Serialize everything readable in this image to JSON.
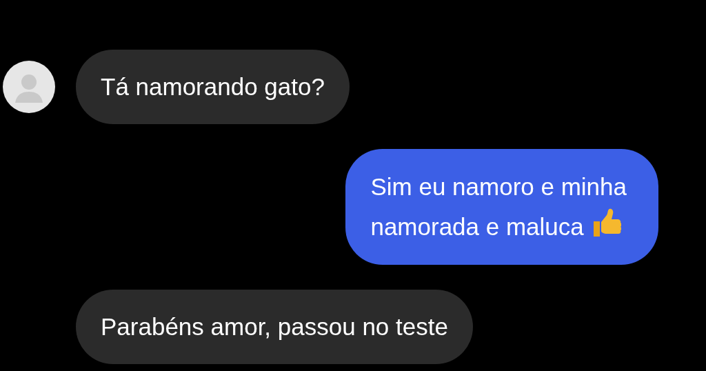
{
  "messages": [
    {
      "kind": "received",
      "show_avatar": true,
      "lines": [
        "Tá namorando gato?"
      ]
    },
    {
      "kind": "sent",
      "show_avatar": false,
      "lines": [
        "Sim eu namoro e minha",
        "namorada e maluca"
      ],
      "thumbs_up": true
    },
    {
      "kind": "received",
      "show_avatar": false,
      "lines": [
        "Parabéns amor, passou no teste"
      ]
    }
  ]
}
